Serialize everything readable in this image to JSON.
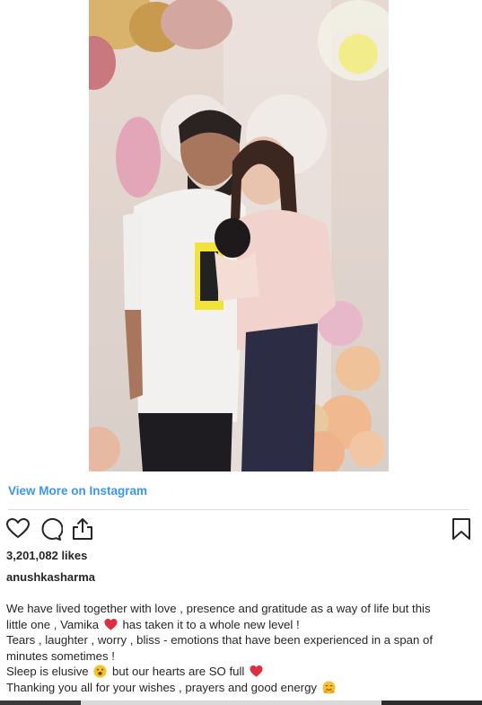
{
  "post": {
    "view_more_label": "View More on Instagram",
    "likes": "3,201,082 likes",
    "username": "anushkasharma",
    "caption": {
      "line1": "We have lived together with love , presence and gratitude as a way of life but this",
      "line2a": "little one , Vamika",
      "line2b": "has taken it to a whole new level !",
      "line3": "Tears , laughter , worry , bliss - emotions that have been experienced in a span of",
      "line4": "minutes sometimes !",
      "line5a": "Sleep is elusive",
      "line5b": "but our hearts are SO full",
      "line6": "Thanking you all for your wishes , prayers and good energy"
    }
  },
  "icons": {
    "like": "heart-outline-icon",
    "comment": "comment-bubble-icon",
    "share": "share-upload-icon",
    "save": "bookmark-icon",
    "emoji_heart": "red-heart-emoji",
    "emoji_smile": "smiling-face-emoji",
    "emoji_hug": "hugging-face-emoji"
  },
  "colors": {
    "link": "#3897f0",
    "text": "#262626",
    "divider": "#dbdbdb",
    "heart": "#e0245e"
  }
}
